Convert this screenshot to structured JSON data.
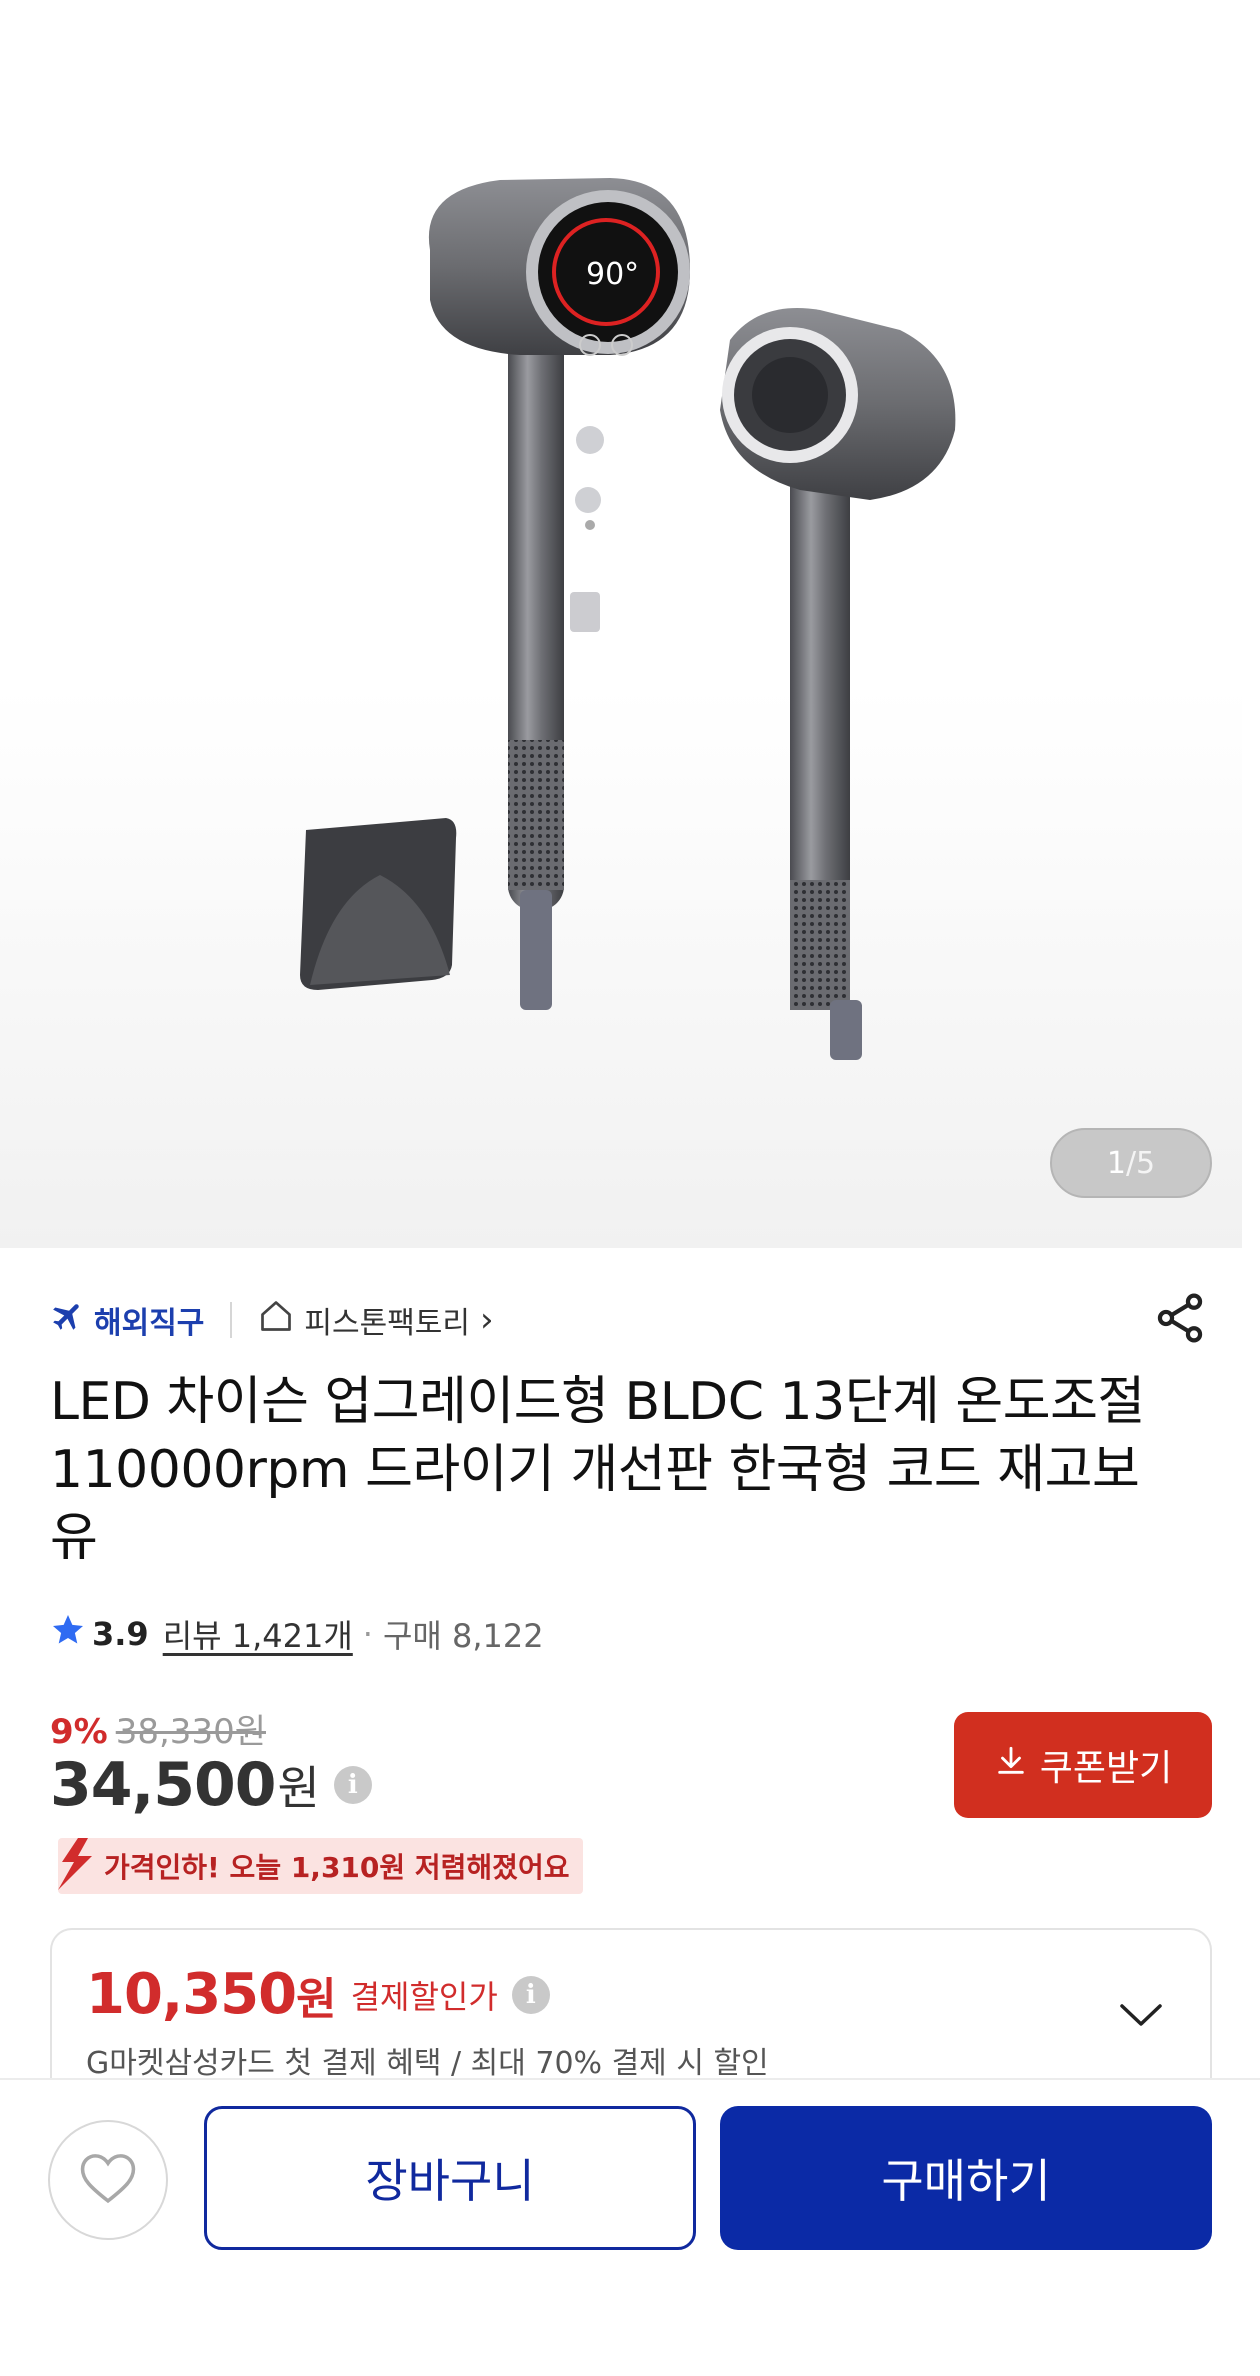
{
  "gallery": {
    "current": "1",
    "separator": "/",
    "total": "5",
    "image_desc_icon": "hair-dryer-product-image"
  },
  "seller": {
    "overseas_label": "해외직구",
    "store_name": "피스톤팩토리",
    "store_arrow": "›"
  },
  "product": {
    "title": "LED 차이슨 업그레이드형 BLDC 13단계 온도조절 110000rpm 드라이기 개선판 한국형 코드 재고보유",
    "rating": "3.9",
    "reviews": "리뷰 1,421개",
    "dot": "·",
    "purchases": "구매 8,122"
  },
  "price": {
    "discount_rate": "9%",
    "original": "38,330원",
    "sale_number": "34,500",
    "sale_unit": "원",
    "info_glyph": "i",
    "coupon_label": "쿠폰받기",
    "drop_notice": "가격인하! 오늘 1,310원 저렴해졌어요"
  },
  "payment": {
    "price_number": "10,350",
    "price_unit": "원",
    "label": "결제할인가",
    "info_glyph": "i",
    "description": "G마켓삼성카드 첫 결제 혜택 / 최대 70% 결제 시 할인"
  },
  "actions": {
    "cart_label": "장바구니",
    "buy_label": "구매하기"
  },
  "colors": {
    "brand_blue": "#0b2aa6",
    "accent_red": "#d12f1f",
    "discount_red": "#d12c2c"
  },
  "icons": [
    "airplane-icon",
    "home-icon",
    "share-icon",
    "star-icon",
    "info-icon",
    "download-icon",
    "price-drop-arrow-icon",
    "chevron-down-icon",
    "heart-icon"
  ]
}
